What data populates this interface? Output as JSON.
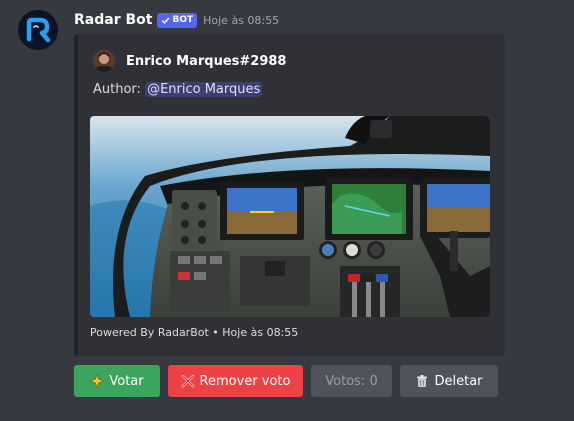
{
  "message": {
    "author": "Radar Bot",
    "bot_tag": "BOT",
    "timestamp": "Hoje às 08:55"
  },
  "embed": {
    "author_name": "Enrico Marques#2988",
    "description_prefix": "Author: ",
    "mention": "@Enrico Marques",
    "footer": "Powered By RadarBot • Hoje às 08:55"
  },
  "buttons": {
    "vote": "Votar",
    "remove_vote": "Remover voto",
    "votes_count": "Votos: 0",
    "delete": "Deletar"
  },
  "colors": {
    "background": "#36393f",
    "embed_bg": "#2f3136",
    "vote_green": "#3ba55d",
    "remove_red": "#ed4245",
    "secondary_gray": "#4f545c",
    "bot_tag_blue": "#5865f2"
  },
  "icons": {
    "vote": "sparkle-star-icon",
    "remove": "cross-mark-icon",
    "delete": "trash-can-icon",
    "verified": "checkmark-icon"
  }
}
